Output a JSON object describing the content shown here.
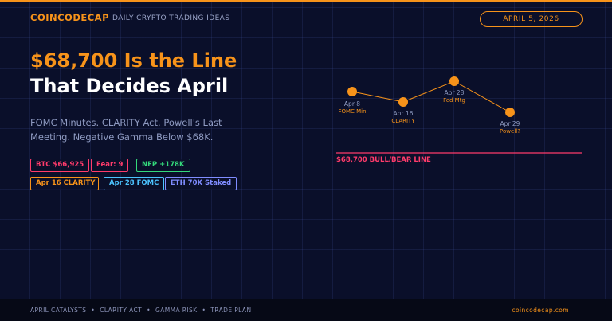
{
  "header": {
    "brand": "COINCODECAP",
    "tagline": "DAILY CRYPTO TRADING IDEAS",
    "date": "APRIL 5, 2026"
  },
  "hero": {
    "title_line1": "$68,700 Is the Line",
    "title_line2": "That Decides April",
    "subtitle": "FOMC Minutes. CLARITY Act. Powell's Last Meeting. Negative Gamma Below $68K."
  },
  "chips": {
    "btc": "BTC $66,925",
    "fear": "Fear: 9",
    "nfp": "NFP +178K",
    "clarity": "Apr 16 CLARITY",
    "fomc": "Apr 28 FOMC",
    "eth": "ETH 70K Staked"
  },
  "timeline": {
    "events": [
      {
        "date": "Apr 8",
        "label": "FOMC Min"
      },
      {
        "date": "Apr 16",
        "label": "CLARITY"
      },
      {
        "date": "Apr 28",
        "label": "Fed Mtg"
      },
      {
        "date": "Apr 29",
        "label": "Powell?"
      }
    ],
    "line_label": "$68,700 BULL/BEAR LINE"
  },
  "colors": {
    "accent": "#f7931a",
    "danger": "#ff3b6b",
    "green": "#34d97b",
    "blue": "#4cc3ff",
    "purple": "#7f8cff",
    "background": "#0a0f2a"
  },
  "footer": {
    "items": [
      "APRIL CATALYSTS",
      "CLARITY ACT",
      "GAMMA RISK",
      "TRADE PLAN"
    ],
    "site": "coincodecap.com"
  }
}
